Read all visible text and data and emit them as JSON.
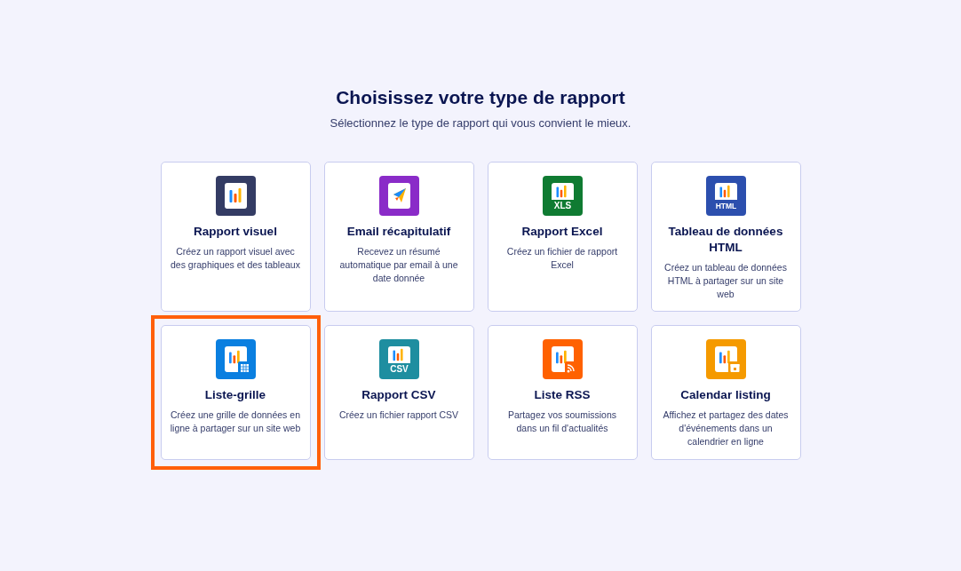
{
  "title": "Choisissez votre type de rapport",
  "subtitle": "Sélectionnez le type de rapport qui vous convient le mieux.",
  "cards": [
    {
      "kind": "visual",
      "color": "#343c64",
      "title": "Rapport visuel",
      "description": "Créez un rapport visuel avec des graphiques et des tableaux",
      "selected": false
    },
    {
      "kind": "email",
      "color": "#8a2bc8",
      "title": "Email récapitulatif",
      "description": "Recevez un résumé automatique par email à une date donnée",
      "selected": false
    },
    {
      "kind": "badge",
      "color": "#0f7b32",
      "badge": "XLS",
      "title": "Rapport Excel",
      "description": "Créez un fichier de rapport Excel",
      "selected": false
    },
    {
      "kind": "badge",
      "color": "#2c4fae",
      "badge": "HTML",
      "title": "Tableau de données HTML",
      "description": "Créez un tableau de données HTML à partager sur un site web",
      "selected": false
    },
    {
      "kind": "grid",
      "color": "#0a7fe0",
      "title": "Liste-grille",
      "description": "Créez une grille de données en ligne à partager sur un site web",
      "selected": true
    },
    {
      "kind": "badge",
      "color": "#1e8ea0",
      "badge": "CSV",
      "title": "Rapport CSV",
      "description": "Créez un fichier rapport CSV",
      "selected": false
    },
    {
      "kind": "rss",
      "color": "#ff6100",
      "title": "Liste RSS",
      "description": "Partagez vos soumissions dans un fil d'actualités",
      "selected": false
    },
    {
      "kind": "calendar",
      "color": "#f59a00",
      "title": "Calendar listing",
      "description": "Affichez et partagez des dates d'événements dans un calendrier en ligne",
      "selected": false
    }
  ]
}
